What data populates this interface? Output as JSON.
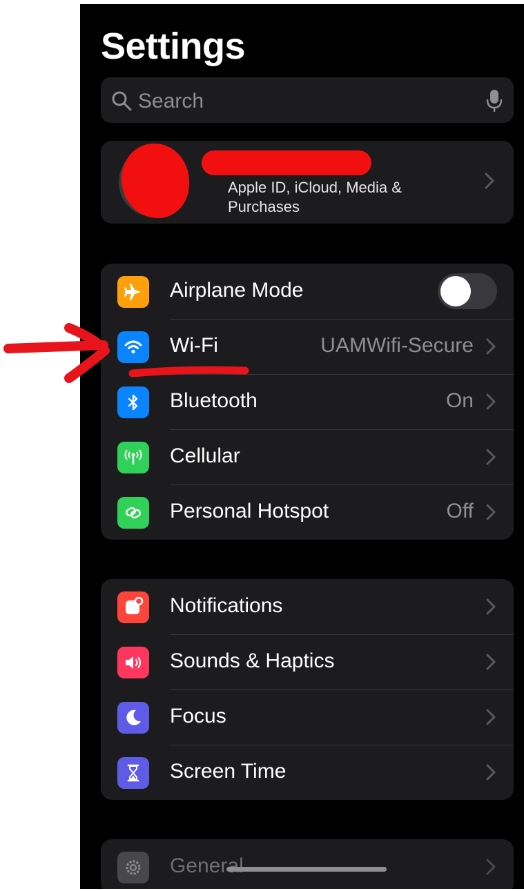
{
  "page": {
    "title": "Settings"
  },
  "search": {
    "placeholder": "Search"
  },
  "profile": {
    "name": "",
    "subtitle": "Apple ID, iCloud, Media & Purchases"
  },
  "connectivity": [
    {
      "label": "Airplane Mode",
      "value": "",
      "icon": "airplane-icon",
      "color": "#ff9f0a",
      "toggle": "off"
    },
    {
      "label": "Wi-Fi",
      "value": "UAMWifi-Secure",
      "icon": "wifi-icon",
      "color": "#0a84ff"
    },
    {
      "label": "Bluetooth",
      "value": "On",
      "icon": "bluetooth-icon",
      "color": "#0a84ff"
    },
    {
      "label": "Cellular",
      "value": "",
      "icon": "cellular-icon",
      "color": "#30d158"
    },
    {
      "label": "Personal Hotspot",
      "value": "Off",
      "icon": "hotspot-icon",
      "color": "#30d158"
    }
  ],
  "alerts": [
    {
      "label": "Notifications",
      "icon": "notifications-icon",
      "color": "#ff453a"
    },
    {
      "label": "Sounds & Haptics",
      "icon": "sounds-icon",
      "color": "#ff375f"
    },
    {
      "label": "Focus",
      "icon": "moon-icon",
      "color": "#5e5ce6"
    },
    {
      "label": "Screen Time",
      "icon": "hourglass-icon",
      "color": "#5e5ce6"
    }
  ],
  "general": {
    "label": "General",
    "icon": "gear-icon"
  },
  "colors": {
    "annotation": "#e8141b",
    "background": "#000000",
    "cell": "#1c1c1e"
  }
}
